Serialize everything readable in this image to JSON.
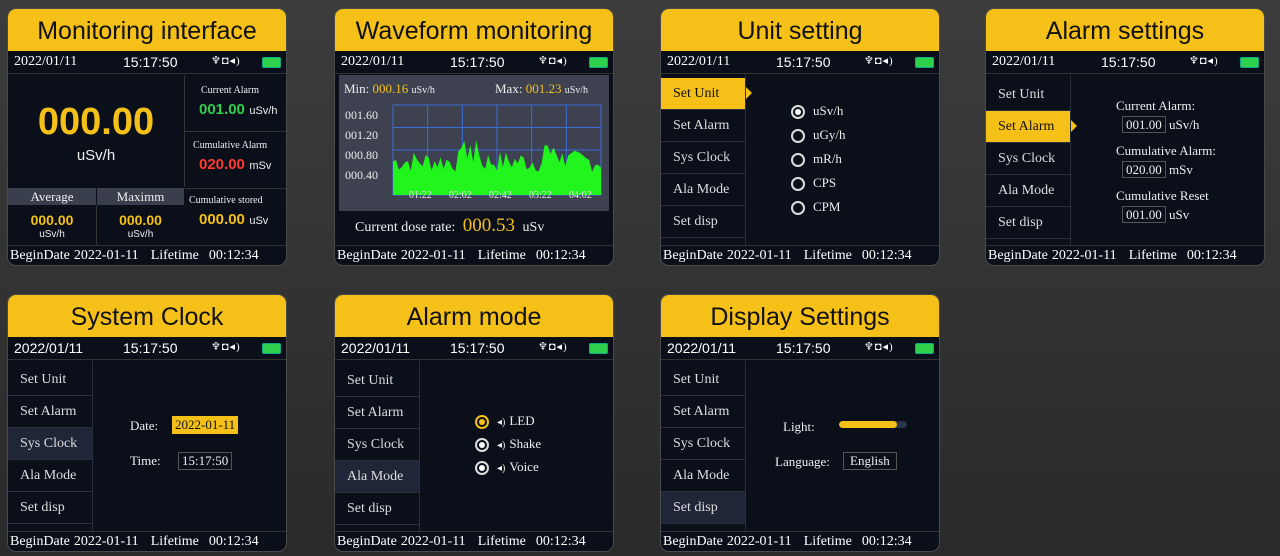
{
  "common": {
    "date": "2022/01/11",
    "time": "15:17:50",
    "status_icons": "♆◘◂)",
    "footer_begin": "BeginDate",
    "footer_begin_date": "2022-01-11",
    "footer_lifetime": "Lifetime",
    "footer_lifetime_value": "00:12:34"
  },
  "menu": [
    "Set Unit",
    "Set Alarm",
    "Sys Clock",
    "Ala Mode",
    "Set disp"
  ],
  "cards": {
    "monitoring": {
      "title": "Monitoring interface",
      "big_value": "000.00",
      "big_unit": "uSv/h",
      "current_alarm_label": "Current Alarm",
      "current_alarm_value": "001.00",
      "current_alarm_unit": "uSv/h",
      "cumulative_alarm_label": "Cumulative Alarm",
      "cumulative_alarm_value": "020.00",
      "cumulative_alarm_unit": "mSv",
      "cumulative_stored_label": "Cumulative stored",
      "cumulative_stored_value": "000.00",
      "cumulative_stored_unit": "uSv",
      "average_label": "Average",
      "average_value": "000.00",
      "average_unit": "uSv/h",
      "maximum_label": "Maximm",
      "maximum_value": "000.00",
      "maximum_unit": "uSv/h"
    },
    "waveform": {
      "title": "Waveform monitoring",
      "min_label": "Min:",
      "min_value": "000.16",
      "min_unit": "uSv/h",
      "max_label": "Max:",
      "max_value": "001.23",
      "max_unit": "uSv/h",
      "y_ticks": [
        "001.60",
        "001.20",
        "000.80",
        "000.40"
      ],
      "x_ticks": [
        "01:22",
        "02:02",
        "02:42",
        "03:22",
        "04:02"
      ],
      "current_label": "Current dose rate:",
      "current_value": "000.53",
      "current_unit": "uSv"
    },
    "unit": {
      "title": "Unit setting",
      "options": [
        "uSv/h",
        "uGy/h",
        "mR/h",
        "CPS",
        "CPM"
      ],
      "selected_index": 0
    },
    "alarm": {
      "title": "Alarm settings",
      "current_label": "Current Alarm:",
      "current_value": "001.00",
      "current_unit": "uSv/h",
      "cumulative_label": "Cumulative Alarm:",
      "cumulative_value": "020.00",
      "cumulative_unit": "mSv",
      "reset_label": "Cumulative Reset",
      "reset_value": "001.00",
      "reset_unit": "uSv"
    },
    "clock": {
      "title": "System Clock",
      "date_label": "Date:",
      "date_value": "2022-01-11",
      "time_label": "Time:",
      "time_value": "15:17:50"
    },
    "alarm_mode": {
      "title": "Alarm mode",
      "options": [
        "LED",
        "Shake",
        "Voice"
      ]
    },
    "display": {
      "title": "Display Settings",
      "light_label": "Light:",
      "light_level": 0.85,
      "language_label": "Language:",
      "language_value": "English"
    }
  },
  "colors": {
    "accent": "#f5c018",
    "green": "#2fd04b",
    "red": "#ff3b2f",
    "panel": "#0b0f1a"
  }
}
